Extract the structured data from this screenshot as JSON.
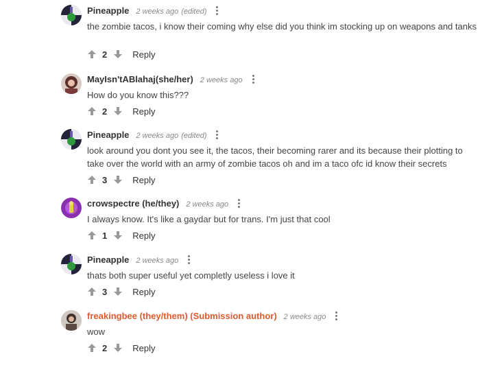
{
  "comments": [
    {
      "author": "Pineapple",
      "time": "2 weeks ago",
      "edited": "(edited)",
      "text": "the zombie tacos, i know their coming why else did you think im stocking up on weapons and tanks",
      "score": "2",
      "reply": "Reply",
      "avatar": "pineapple-avatar"
    },
    {
      "author": "MayIsn'tABlahaj(she/her)",
      "time": "2 weeks ago",
      "text": "How do you know this???",
      "score": "2",
      "reply": "Reply",
      "avatar": "maytabaj-avatar"
    },
    {
      "author": "Pineapple",
      "time": "2 weeks ago",
      "edited": "(edited)",
      "text_line1": "look around you dont you see it, the tacos, their becoming rarer and its because their plotting to",
      "text_line2": "take over the world with an army of zombie tacos oh and im a taco ofc id know their secrets",
      "score": "3",
      "reply": "Reply",
      "avatar": "pineapple-avatar"
    },
    {
      "author": "crowspectre (he/they)",
      "time": "2 weeks ago",
      "text": "I always know. It's like a gaydar but for trans. I'm just that cool",
      "score": "1",
      "reply": "Reply",
      "avatar": "crowspectre-avatar"
    },
    {
      "author": "Pineapple",
      "time": "2 weeks ago",
      "text": "thats both super useful yet completly useless i love it",
      "score": "3",
      "reply": "Reply",
      "avatar": "pineapple-avatar"
    },
    {
      "author": "freakingbee (they/them) (Submission author)",
      "time": "2 weeks ago",
      "text": "wow",
      "score": "2",
      "reply": "Reply",
      "avatar": "freakingbee-avatar"
    }
  ],
  "colors": {
    "author": "#333333",
    "submission_author": "#e15a2e",
    "meta": "#888888",
    "arrow": "#999999"
  }
}
